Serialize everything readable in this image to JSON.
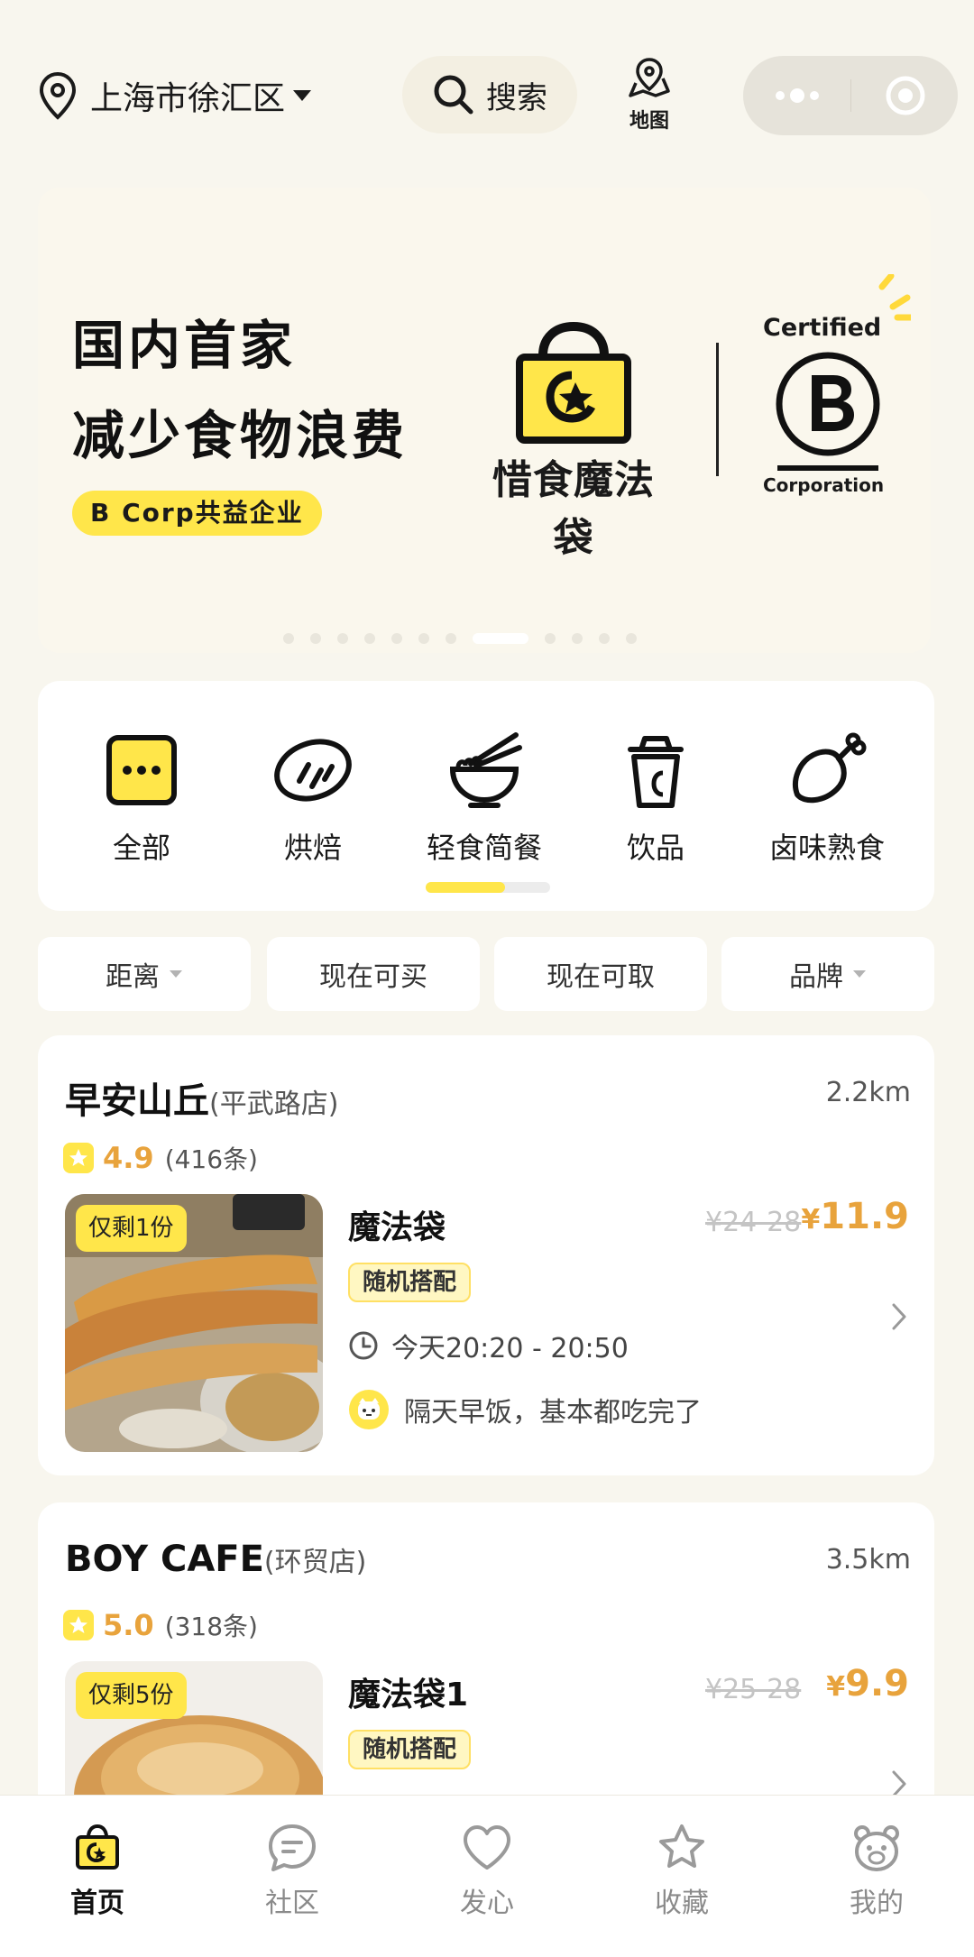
{
  "header": {
    "location": "上海市徐汇区",
    "search_label": "搜索",
    "map_label": "地图"
  },
  "banner": {
    "headline_1": "国内首家",
    "headline_2": "减少食物浪费",
    "pill": "B Corp共益企业",
    "brand_name": "惜食魔法袋",
    "certified": "Certified",
    "corporation": "Corporation",
    "total_dots": 12,
    "active_dot": 8
  },
  "categories": [
    {
      "label": "全部",
      "icon": "all-grid-icon"
    },
    {
      "label": "烘焙",
      "icon": "bread-icon"
    },
    {
      "label": "轻食简餐",
      "icon": "noodle-bowl-icon"
    },
    {
      "label": "饮品",
      "icon": "drink-cup-icon"
    },
    {
      "label": "卤味熟食",
      "icon": "chicken-leg-icon"
    }
  ],
  "filters": [
    {
      "label": "距离",
      "has_caret": true
    },
    {
      "label": "现在可买",
      "has_caret": false
    },
    {
      "label": "现在可取",
      "has_caret": false
    },
    {
      "label": "品牌",
      "has_caret": true
    }
  ],
  "stores": [
    {
      "name": "早安山丘",
      "branch": "(平武路店)",
      "distance": "2.2km",
      "rating": "4.9",
      "review_count": "(416条)",
      "stock": "仅剩1份",
      "product": "魔法袋",
      "original_price": "¥24-28",
      "price_symbol": "¥",
      "price": "11.9",
      "tag": "随机搭配",
      "pickup_time": "今天20:20 - 20:50",
      "comment": "隔天早饭，基本都吃完了"
    },
    {
      "name": "BOY CAFE",
      "branch": "(环贸店)",
      "distance": "3.5km",
      "rating": "5.0",
      "review_count": "(318条)",
      "stock": "仅剩5份",
      "product": "魔法袋1",
      "original_price": "¥25-28",
      "price_symbol": "¥",
      "price": "9.9",
      "tag": "随机搭配"
    }
  ],
  "tabbar": [
    {
      "label": "首页",
      "icon": "home-bag-icon",
      "active": true
    },
    {
      "label": "社区",
      "icon": "chat-bubble-icon",
      "active": false
    },
    {
      "label": "发心",
      "icon": "heart-icon",
      "active": false
    },
    {
      "label": "收藏",
      "icon": "star-icon",
      "active": false
    },
    {
      "label": "我的",
      "icon": "bear-face-icon",
      "active": false
    }
  ],
  "colors": {
    "background": "#f8f6ee",
    "accent_yellow": "#ffe64a",
    "price_orange": "#e8a33c"
  }
}
